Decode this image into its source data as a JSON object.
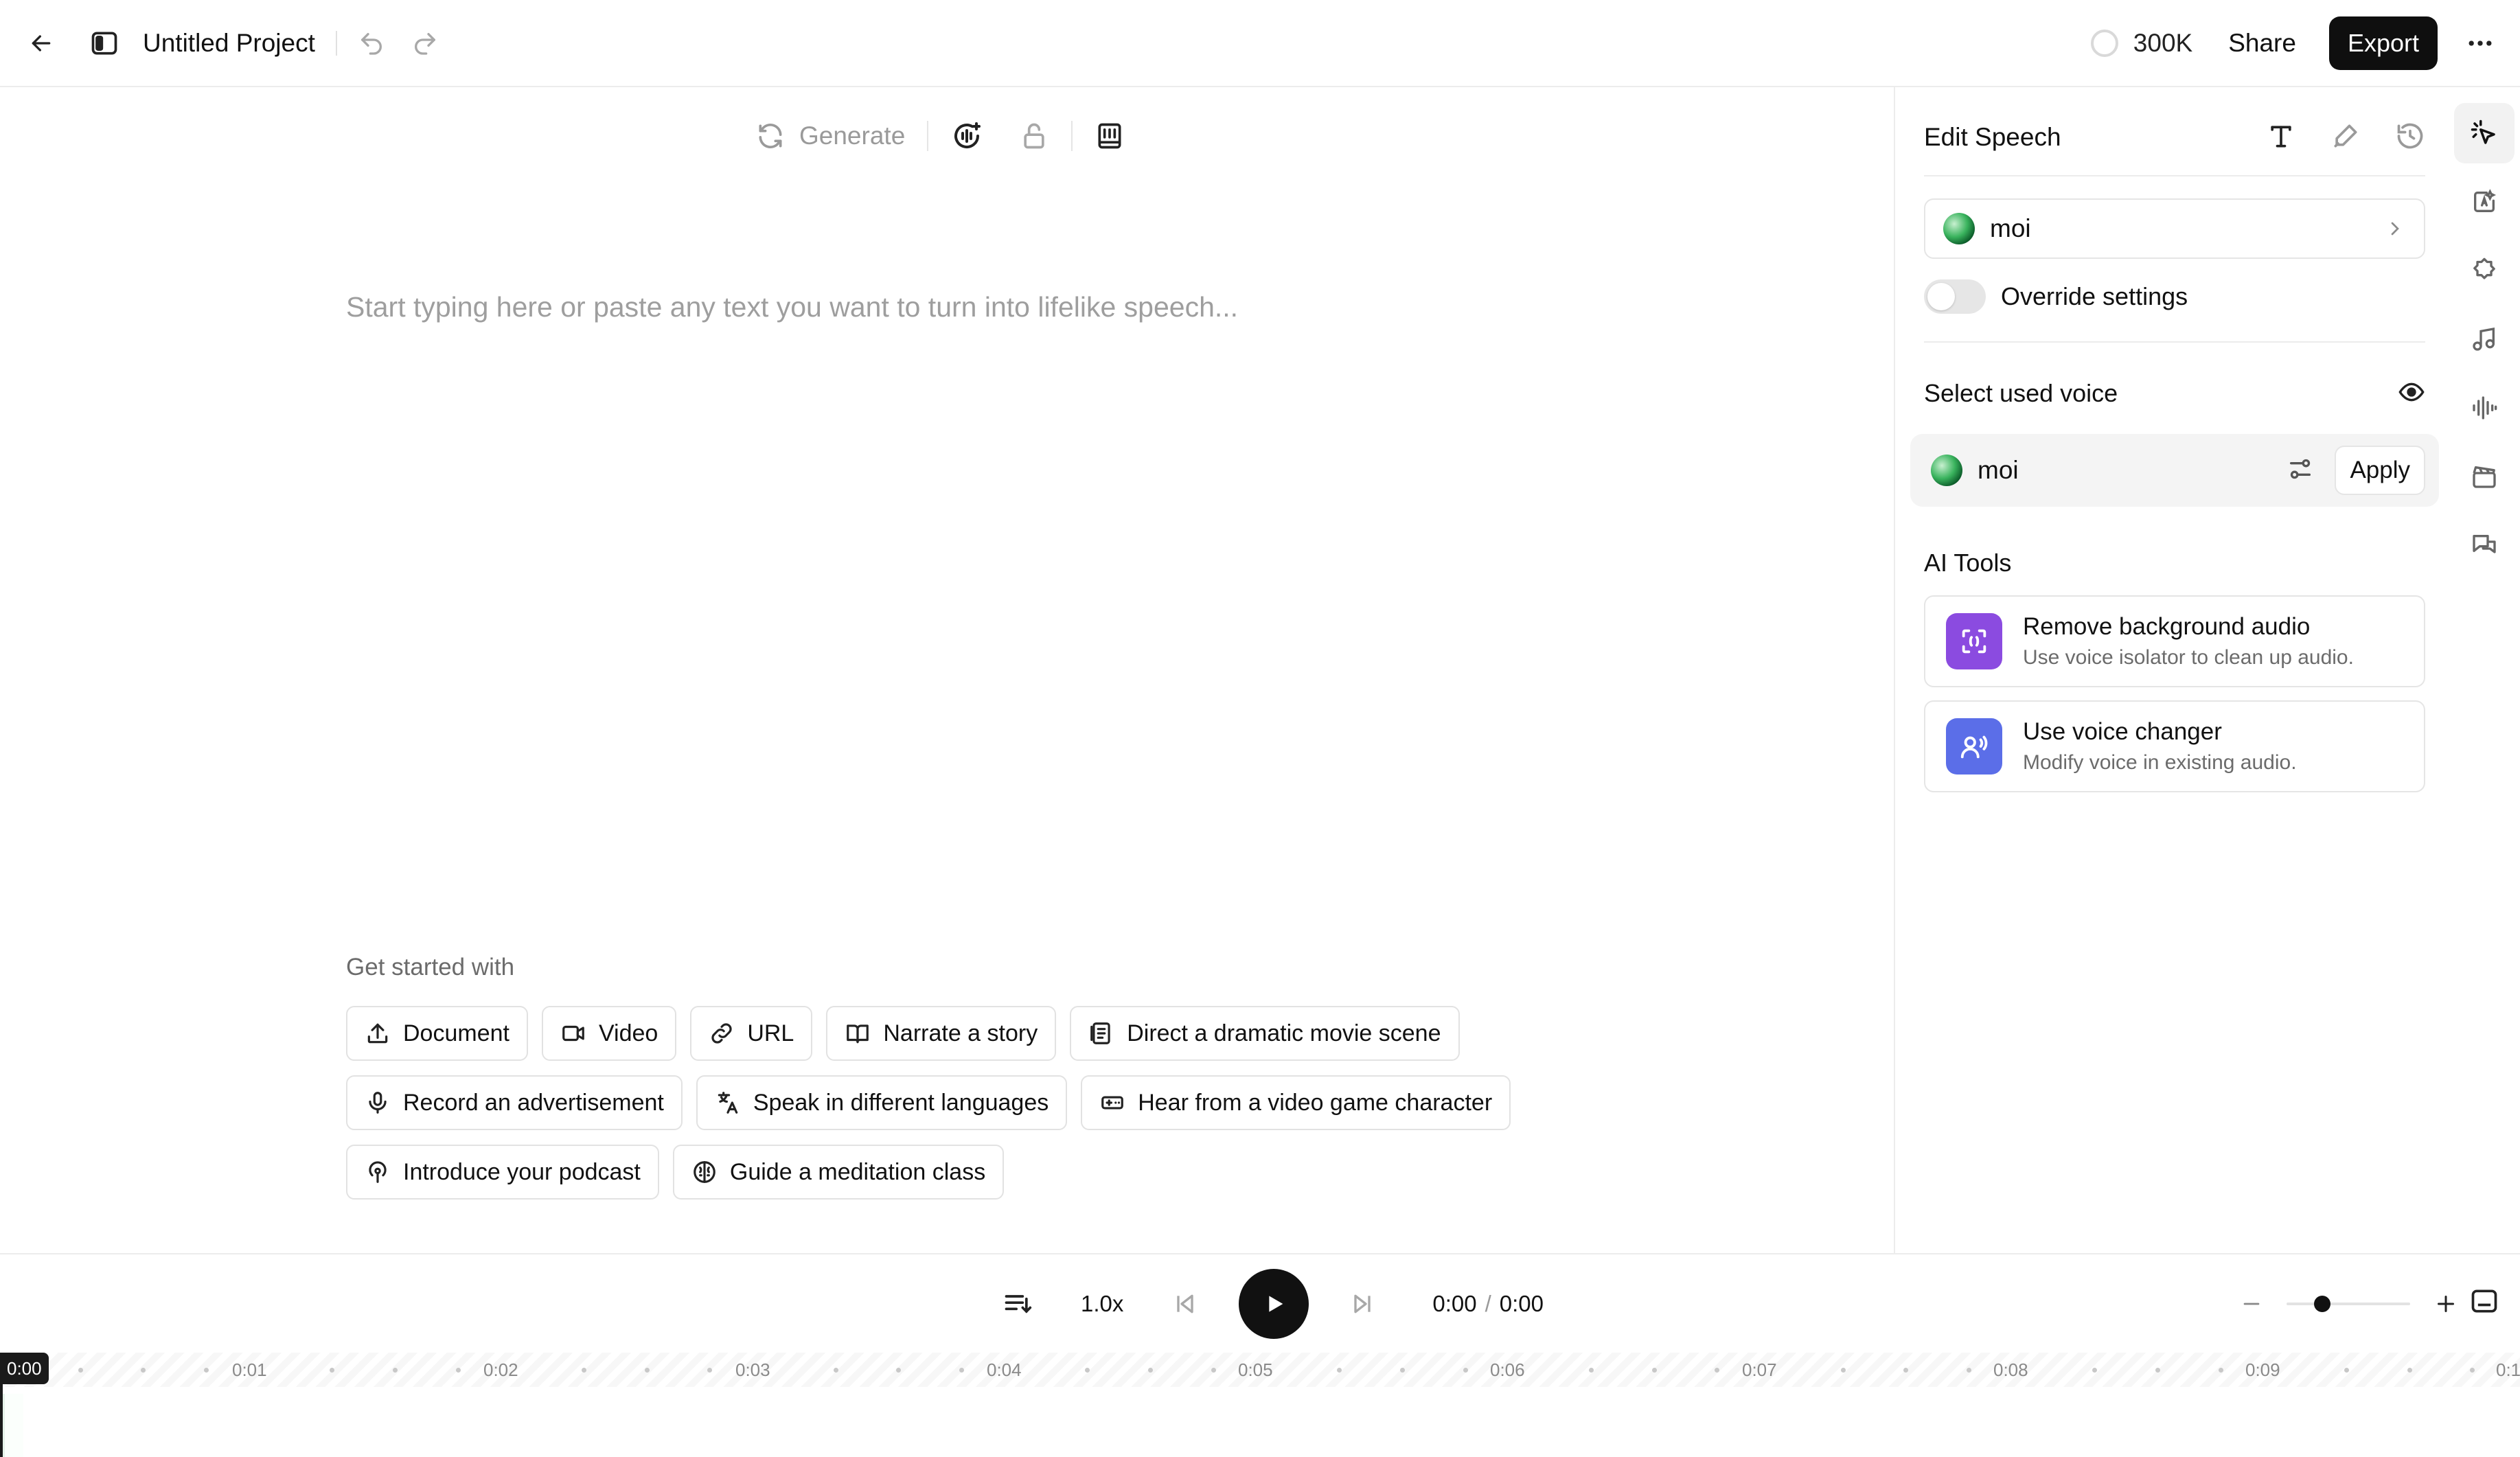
{
  "topbar": {
    "project_title": "Untitled Project",
    "credits": "300K",
    "share_label": "Share",
    "export_label": "Export"
  },
  "editor": {
    "generate_label": "Generate",
    "placeholder": "Start typing here or paste any text you want to turn into lifelike speech...",
    "get_started_title": "Get started with",
    "chips": [
      [
        "Document",
        "Video",
        "URL",
        "Narrate a story",
        "Direct a dramatic movie scene"
      ],
      [
        "Record an advertisement",
        "Speak in different languages",
        "Hear from a video game character"
      ],
      [
        "Introduce your podcast",
        "Guide a meditation class"
      ]
    ]
  },
  "panel": {
    "title": "Edit Speech",
    "voice_name": "moi",
    "override_label": "Override settings",
    "override_on": false,
    "select_voice_title": "Select used voice",
    "used_voice_name": "moi",
    "apply_label": "Apply",
    "ai_tools_title": "AI Tools",
    "ai_tools": [
      {
        "name": "Remove background audio",
        "desc": "Use voice isolator to clean up audio.",
        "color": "#8b4be0"
      },
      {
        "name": "Use voice changer",
        "desc": "Modify voice in existing audio.",
        "color": "#5b6ee8"
      }
    ]
  },
  "player": {
    "speed": "1.0x",
    "current_time": "0:00",
    "separator": "/",
    "total_time": "0:00"
  },
  "timeline": {
    "cursor_time": "0:00",
    "ticks": [
      "0:01",
      "0:02",
      "0:03",
      "0:04",
      "0:05",
      "0:06",
      "0:07",
      "0:08",
      "0:09",
      "0:1"
    ]
  }
}
